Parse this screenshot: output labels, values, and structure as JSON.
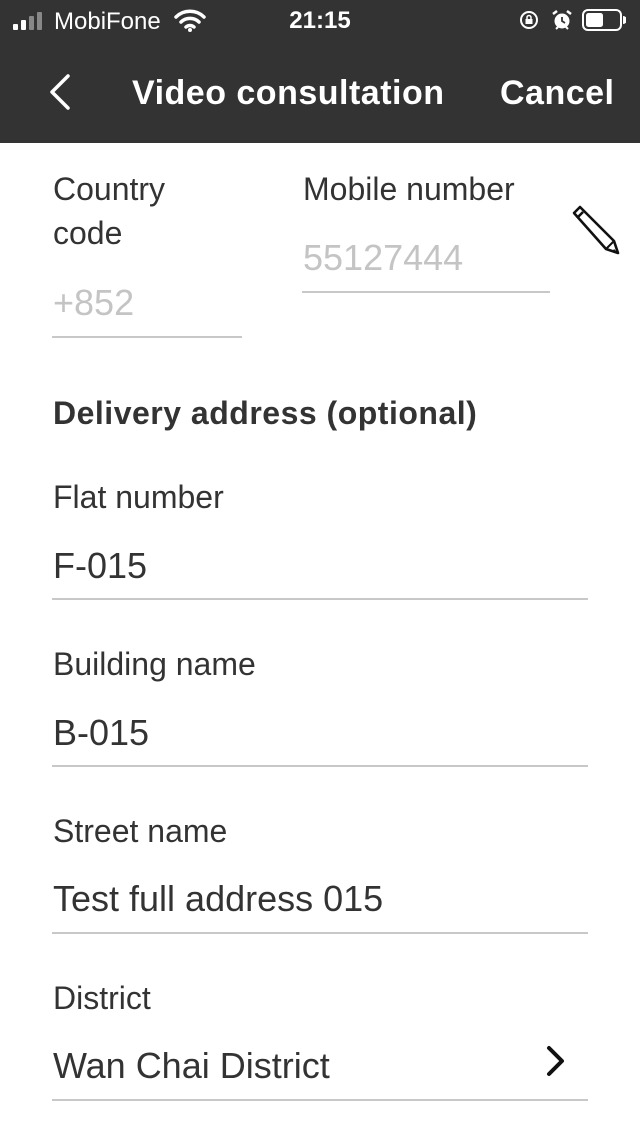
{
  "status_bar": {
    "carrier": "MobiFone",
    "time": "21:15"
  },
  "nav": {
    "title": "Video consultation",
    "cancel_label": "Cancel"
  },
  "phone": {
    "country_code_label_line1": "Country",
    "country_code_label_line2": "code",
    "country_code_placeholder": "+852",
    "mobile_label": "Mobile number",
    "mobile_placeholder": "55127444"
  },
  "address": {
    "section_title": "Delivery address (optional)",
    "flat_label": "Flat number",
    "flat_value": "F-015",
    "building_label": "Building name",
    "building_value": "B-015",
    "street_label": "Street name",
    "street_value": "Test full address 015",
    "district_label": "District",
    "district_value": "Wan Chai District"
  },
  "colors": {
    "nav_background": "#333333",
    "text": "#333333",
    "placeholder": "#c4c4c4",
    "divider": "#c8c8c8"
  },
  "icons": [
    "signal-icon",
    "wifi-icon",
    "lock-rotation-icon",
    "alarm-icon",
    "battery-icon",
    "back-icon",
    "pencil-icon",
    "chevron-right-icon"
  ]
}
